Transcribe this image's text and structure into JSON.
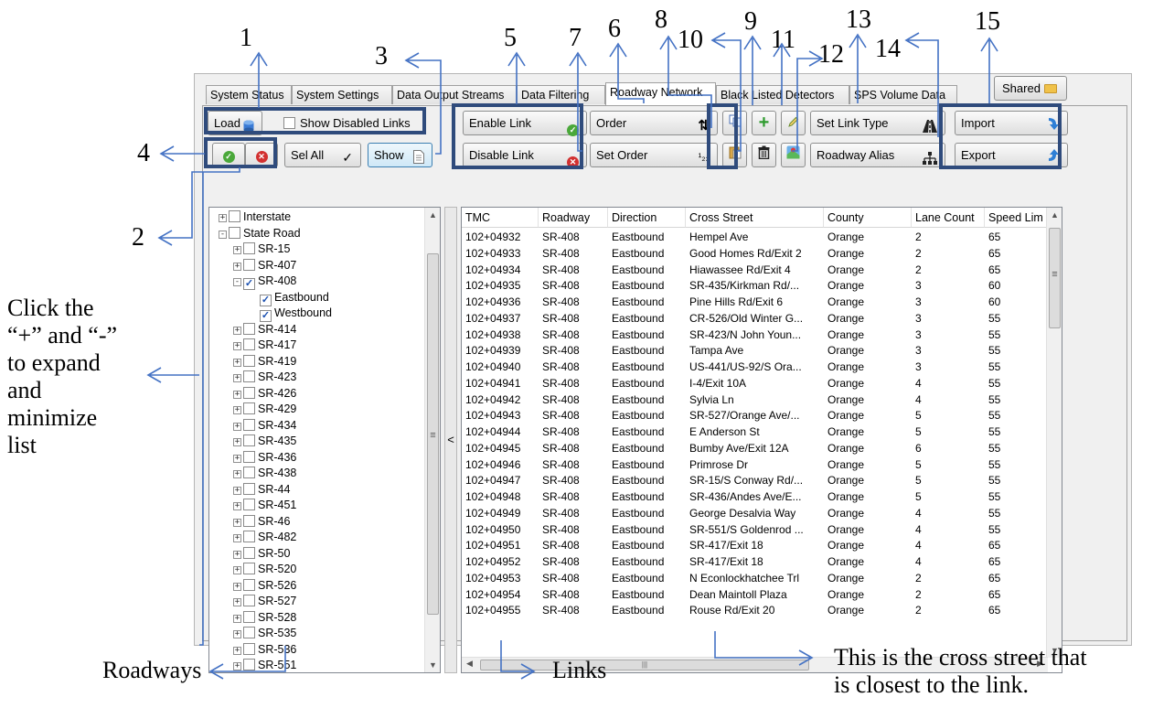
{
  "annotations": {
    "numbers": [
      "1",
      "2",
      "3",
      "4",
      "5",
      "6",
      "7",
      "8",
      "9",
      "10",
      "11",
      "12",
      "13",
      "14",
      "15"
    ],
    "expand_note": [
      "Click the",
      "“+” and “-”",
      "to expand",
      "and",
      "minimize",
      "list"
    ],
    "roadways_label": "Roadways",
    "links_label": "Links",
    "cross_street_note": [
      "This is the cross street that",
      "is closest to the link."
    ]
  },
  "tabs": [
    "System Status",
    "System Settings",
    "Data Output Streams",
    "Data Filtering",
    "Roadway Network",
    "Black Listed Detectors",
    "SPS Volume Data"
  ],
  "active_tab": "Roadway Network",
  "shared_label": "Shared",
  "toolbar": {
    "load_label": "Load",
    "show_disabled_label": "Show Disabled Links",
    "sel_all_label": "Sel All",
    "show_label": "Show",
    "enable_link_label": "Enable Link",
    "disable_link_label": "Disable Link",
    "order_label": "Order",
    "set_order_label": "Set Order",
    "set_link_type_label": "Set Link Type",
    "roadway_alias_label": "Roadway Alias",
    "import_label": "Import",
    "export_label": "Export",
    "add_glyph": "+",
    "sort_glyph": "⇅",
    "order_num_glyph": "¹₂₃",
    "check_glyph": "✓"
  },
  "tree": [
    {
      "label": "Interstate",
      "level": 0,
      "expander": "+",
      "checked": false
    },
    {
      "label": "State Road",
      "level": 0,
      "expander": "-",
      "checked": false
    },
    {
      "label": "SR-15",
      "level": 1,
      "expander": "+",
      "checked": false
    },
    {
      "label": "SR-407",
      "level": 1,
      "expander": "+",
      "checked": false
    },
    {
      "label": "SR-408",
      "level": 1,
      "expander": "-",
      "checked": true
    },
    {
      "label": "Eastbound",
      "level": 2,
      "expander": "",
      "checked": true
    },
    {
      "label": "Westbound",
      "level": 2,
      "expander": "",
      "checked": true
    },
    {
      "label": "SR-414",
      "level": 1,
      "expander": "+",
      "checked": false
    },
    {
      "label": "SR-417",
      "level": 1,
      "expander": "+",
      "checked": false
    },
    {
      "label": "SR-419",
      "level": 1,
      "expander": "+",
      "checked": false
    },
    {
      "label": "SR-423",
      "level": 1,
      "expander": "+",
      "checked": false
    },
    {
      "label": "SR-426",
      "level": 1,
      "expander": "+",
      "checked": false
    },
    {
      "label": "SR-429",
      "level": 1,
      "expander": "+",
      "checked": false
    },
    {
      "label": "SR-434",
      "level": 1,
      "expander": "+",
      "checked": false
    },
    {
      "label": "SR-435",
      "level": 1,
      "expander": "+",
      "checked": false
    },
    {
      "label": "SR-436",
      "level": 1,
      "expander": "+",
      "checked": false
    },
    {
      "label": "SR-438",
      "level": 1,
      "expander": "+",
      "checked": false
    },
    {
      "label": "SR-44",
      "level": 1,
      "expander": "+",
      "checked": false
    },
    {
      "label": "SR-451",
      "level": 1,
      "expander": "+",
      "checked": false
    },
    {
      "label": "SR-46",
      "level": 1,
      "expander": "+",
      "checked": false
    },
    {
      "label": "SR-482",
      "level": 1,
      "expander": "+",
      "checked": false
    },
    {
      "label": "SR-50",
      "level": 1,
      "expander": "+",
      "checked": false
    },
    {
      "label": "SR-520",
      "level": 1,
      "expander": "+",
      "checked": false
    },
    {
      "label": "SR-526",
      "level": 1,
      "expander": "+",
      "checked": false
    },
    {
      "label": "SR-527",
      "level": 1,
      "expander": "+",
      "checked": false
    },
    {
      "label": "SR-528",
      "level": 1,
      "expander": "+",
      "checked": false
    },
    {
      "label": "SR-535",
      "level": 1,
      "expander": "+",
      "checked": false
    },
    {
      "label": "SR-536",
      "level": 1,
      "expander": "+",
      "checked": false
    },
    {
      "label": "SR-551",
      "level": 1,
      "expander": "+",
      "checked": false
    }
  ],
  "table": {
    "columns": [
      "TMC",
      "Roadway",
      "Direction",
      "Cross Street",
      "County",
      "Lane Count",
      "Speed Lim"
    ],
    "rows": [
      [
        "102+04932",
        "SR-408",
        "Eastbound",
        "Hempel Ave",
        "Orange",
        "2",
        "65"
      ],
      [
        "102+04933",
        "SR-408",
        "Eastbound",
        "Good Homes Rd/Exit 2",
        "Orange",
        "2",
        "65"
      ],
      [
        "102+04934",
        "SR-408",
        "Eastbound",
        "Hiawassee Rd/Exit 4",
        "Orange",
        "2",
        "65"
      ],
      [
        "102+04935",
        "SR-408",
        "Eastbound",
        "SR-435/Kirkman Rd/...",
        "Orange",
        "3",
        "60"
      ],
      [
        "102+04936",
        "SR-408",
        "Eastbound",
        "Pine Hills Rd/Exit 6",
        "Orange",
        "3",
        "60"
      ],
      [
        "102+04937",
        "SR-408",
        "Eastbound",
        "CR-526/Old Winter G...",
        "Orange",
        "3",
        "55"
      ],
      [
        "102+04938",
        "SR-408",
        "Eastbound",
        "SR-423/N John Youn...",
        "Orange",
        "3",
        "55"
      ],
      [
        "102+04939",
        "SR-408",
        "Eastbound",
        "Tampa Ave",
        "Orange",
        "3",
        "55"
      ],
      [
        "102+04940",
        "SR-408",
        "Eastbound",
        "US-441/US-92/S Ora...",
        "Orange",
        "3",
        "55"
      ],
      [
        "102+04941",
        "SR-408",
        "Eastbound",
        "I-4/Exit 10A",
        "Orange",
        "4",
        "55"
      ],
      [
        "102+04942",
        "SR-408",
        "Eastbound",
        "Sylvia Ln",
        "Orange",
        "4",
        "55"
      ],
      [
        "102+04943",
        "SR-408",
        "Eastbound",
        "SR-527/Orange Ave/...",
        "Orange",
        "5",
        "55"
      ],
      [
        "102+04944",
        "SR-408",
        "Eastbound",
        "E Anderson St",
        "Orange",
        "5",
        "55"
      ],
      [
        "102+04945",
        "SR-408",
        "Eastbound",
        "Bumby Ave/Exit 12A",
        "Orange",
        "6",
        "55"
      ],
      [
        "102+04946",
        "SR-408",
        "Eastbound",
        "Primrose Dr",
        "Orange",
        "5",
        "55"
      ],
      [
        "102+04947",
        "SR-408",
        "Eastbound",
        "SR-15/S Conway Rd/...",
        "Orange",
        "5",
        "55"
      ],
      [
        "102+04948",
        "SR-408",
        "Eastbound",
        "SR-436/Andes Ave/E...",
        "Orange",
        "5",
        "55"
      ],
      [
        "102+04949",
        "SR-408",
        "Eastbound",
        "George Desalvia Way",
        "Orange",
        "4",
        "55"
      ],
      [
        "102+04950",
        "SR-408",
        "Eastbound",
        "SR-551/S Goldenrod ...",
        "Orange",
        "4",
        "55"
      ],
      [
        "102+04951",
        "SR-408",
        "Eastbound",
        "SR-417/Exit 18",
        "Orange",
        "4",
        "65"
      ],
      [
        "102+04952",
        "SR-408",
        "Eastbound",
        "SR-417/Exit 18",
        "Orange",
        "4",
        "65"
      ],
      [
        "102+04953",
        "SR-408",
        "Eastbound",
        "N Econlockhatchee Trl",
        "Orange",
        "2",
        "65"
      ],
      [
        "102+04954",
        "SR-408",
        "Eastbound",
        "Dean Maintoll Plaza",
        "Orange",
        "2",
        "65"
      ],
      [
        "102+04955",
        "SR-408",
        "Eastbound",
        "Rouse Rd/Exit 20",
        "Orange",
        "2",
        "65"
      ]
    ]
  },
  "colors": {
    "annotation_blue": "#4472c4",
    "highlight_box": "#2f4b7c",
    "green": "#4aa83a",
    "red": "#d23030"
  }
}
